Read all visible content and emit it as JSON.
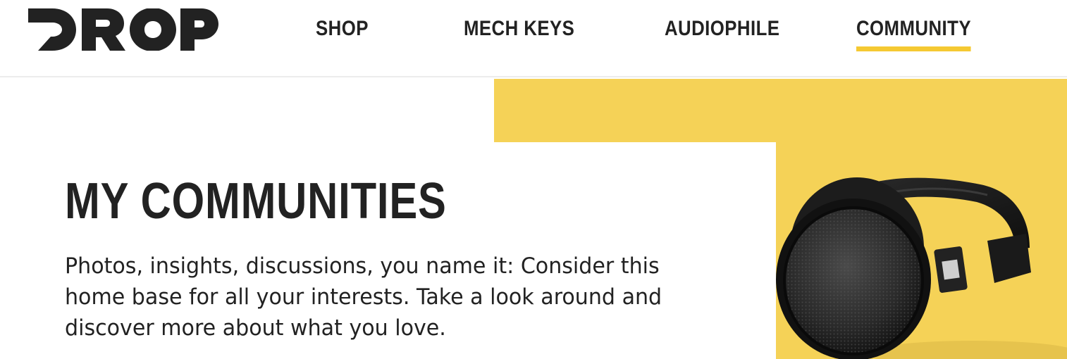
{
  "brand": {
    "logo_text": "DROP",
    "logo_color": "#222222"
  },
  "nav": {
    "items": [
      {
        "label": "SHOP"
      },
      {
        "label": "MECH KEYS"
      },
      {
        "label": "AUDIOPHILE"
      },
      {
        "label": "COMMUNITY",
        "active": true
      }
    ],
    "active_underline_color": "#f5c932"
  },
  "hero": {
    "title": "MY COMMUNITIES",
    "description": "Photos, insights, discussions, you name it: Consider this home base for all your interests. Take a look around and discover more about what you love.",
    "accent_color": "#f5d257",
    "image_subject": "headphones-image"
  }
}
